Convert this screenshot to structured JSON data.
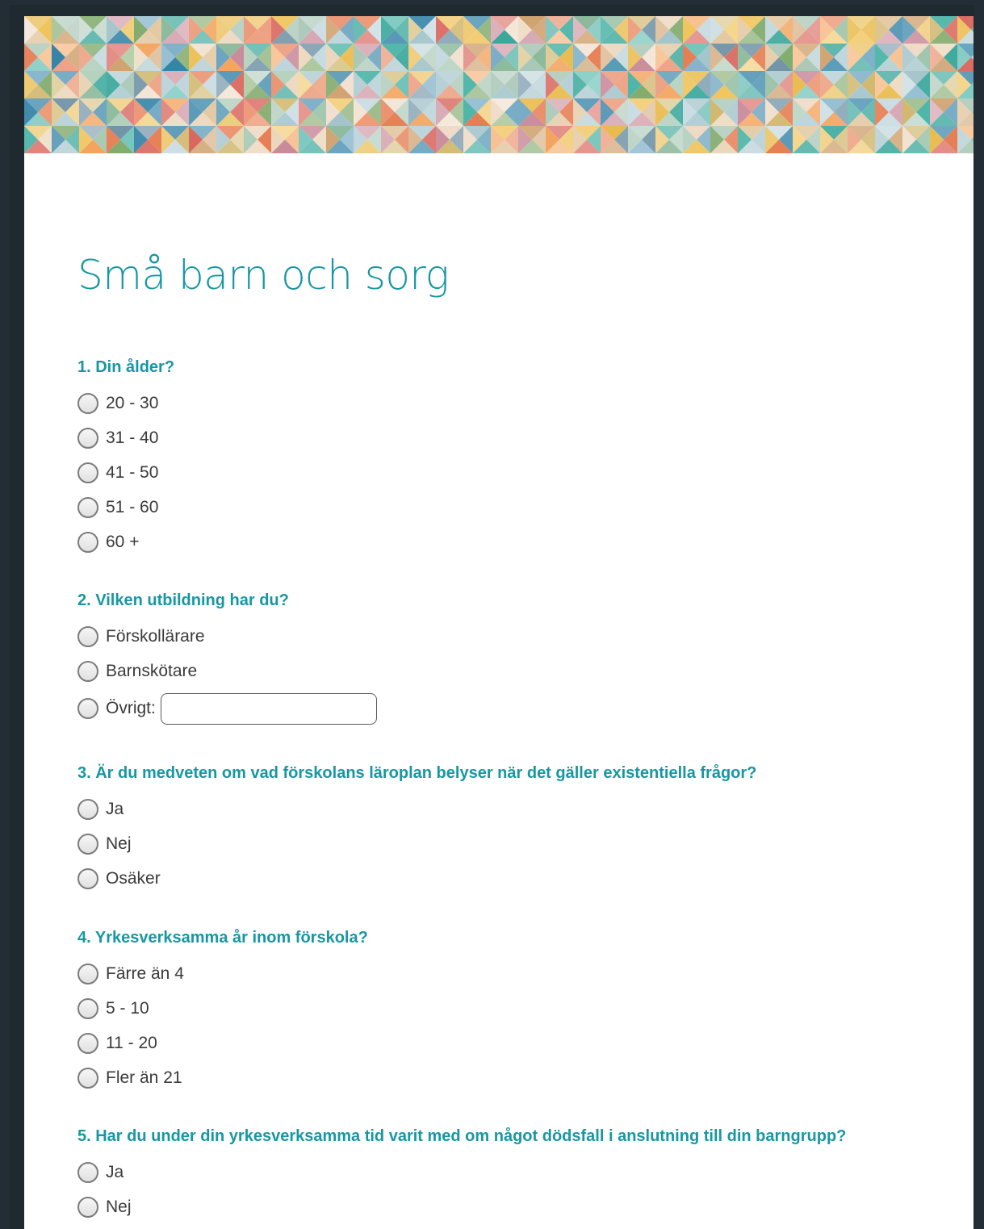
{
  "form": {
    "title": "Små barn och sorg",
    "questions": [
      {
        "title": "1. Din ålder?",
        "options": [
          "20 - 30",
          "31 - 40",
          "41 - 50",
          "51 - 60",
          "60 +"
        ]
      },
      {
        "title": "2. Vilken utbildning har du?",
        "options": [
          "Förskollärare",
          "Barnskötare"
        ],
        "other_label": "Övrigt:",
        "other_value": ""
      },
      {
        "title": "3. Är du medveten om vad förskolans läroplan belyser när det gäller existentiella frågor?",
        "options": [
          "Ja",
          "Nej",
          "Osäker"
        ]
      },
      {
        "title": "4. Yrkesverksamma år inom förskola?",
        "options": [
          "Färre än 4",
          "5 - 10",
          "11 - 20",
          "Fler än 21"
        ]
      },
      {
        "title": "5. Har du under din yrkesverksamma tid varit med om något dödsfall i anslutning till din barngrupp?",
        "options": [
          "Ja",
          "Nej"
        ]
      }
    ]
  },
  "colors": {
    "accent": "#1797a3",
    "text": "#3a3a3a",
    "background": "#232d36",
    "page": "#ffffff"
  },
  "icons": {
    "radio": "radio-button-unselected-icon",
    "banner": "geometric-mosaic-banner"
  }
}
